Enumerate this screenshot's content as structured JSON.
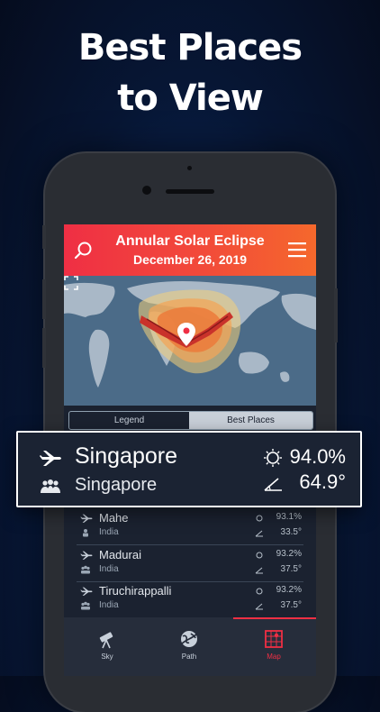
{
  "headline": {
    "line1": "Best Places",
    "line2": "to View"
  },
  "app": {
    "title": "Annular Solar Eclipse",
    "date": "December 26, 2019",
    "accent": "#ef2f44"
  },
  "segmented": {
    "legend_label": "Legend",
    "best_places_label": "Best Places",
    "selected": "Best Places"
  },
  "highlight": {
    "city": "Singapore",
    "country": "Singapore",
    "coverage": "94.0%",
    "altitude": "64.9°"
  },
  "places": [
    {
      "city": "Mahe",
      "country": "India",
      "coverage": "93.1%",
      "altitude": "33.5°"
    },
    {
      "city": "Madurai",
      "country": "India",
      "coverage": "93.2%",
      "altitude": "37.5°"
    },
    {
      "city": "Tiruchirappalli",
      "country": "India",
      "coverage": "93.2%",
      "altitude": "37.5°"
    }
  ],
  "tabs": [
    {
      "label": "Sky",
      "icon": "telescope-icon"
    },
    {
      "label": "Path",
      "icon": "globe-path-icon"
    },
    {
      "label": "Map",
      "icon": "map-grid-icon",
      "active": true
    }
  ]
}
